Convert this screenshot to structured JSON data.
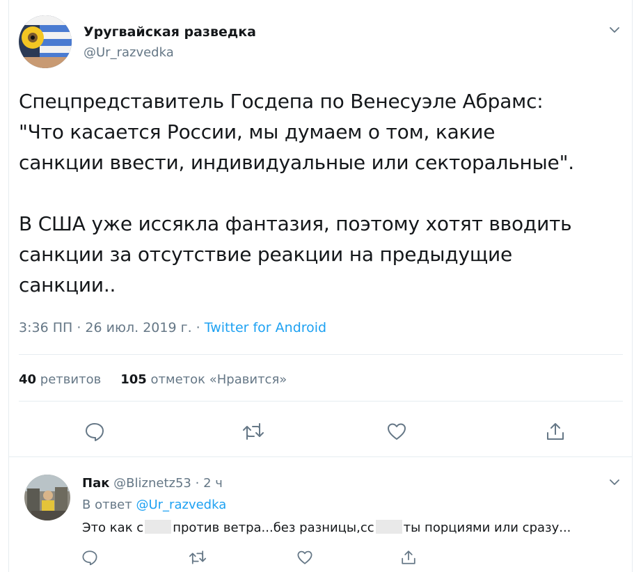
{
  "tweet": {
    "author_name": "Уругвайская разведка",
    "author_handle": "@Ur_razvedka",
    "text": "Спецпредставитель Госдепа по Венесуэле Абрамс:\n\"Что касается России, мы думаем о том, какие\nсанкции ввести, индивидуальные или секторальные\".\n\nВ США уже иссякла фантазия, поэтому хотят вводить\nсанкции за отсутствие реакции на предыдущие\nсанкции..",
    "time": "3:36 ПП",
    "date": "26 июл. 2019 г.",
    "source": "Twitter for Android",
    "retweets_count": "40",
    "retweets_label": "ретвитов",
    "likes_count": "105",
    "likes_label": "отметок «Нравится»"
  },
  "reply": {
    "author_name": "Пак",
    "author_handle": "@Bliznetz53",
    "time": "2 ч",
    "reply_prefix": "В ответ",
    "reply_to": "@Ur_razvedka",
    "text_part1": "Это как с",
    "text_part2": "против ветра...без разницы,сс",
    "text_part3": "ты порциями или сразу..."
  },
  "icons": {
    "reply": "reply-icon",
    "retweet": "retweet-icon",
    "like": "heart-icon",
    "share": "share-icon",
    "menu": "chevron-down-icon"
  },
  "colors": {
    "accent": "#1da1f2",
    "secondary_text": "#657786",
    "primary_text": "#14171a",
    "border": "#e6ecf0"
  }
}
